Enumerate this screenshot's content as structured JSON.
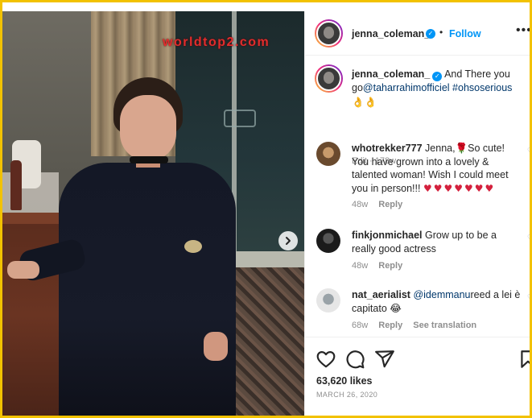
{
  "watermark": "worldtop2.com",
  "header": {
    "username": "jenna_coleman_",
    "separator": "•",
    "follow_label": "Follow",
    "more_label": "•••",
    "verified_mark": "✓"
  },
  "caption": {
    "username": "jenna_coleman_",
    "text": "And There you go",
    "mention": "@taharrahimofficiel",
    "hashtag": "#ohsoserious",
    "emoji": "👌👌",
    "edit_label": "Edit",
    "time": "178w"
  },
  "comments": [
    {
      "username": "whotrekker777",
      "text": "Jenna,🌹So cute! You have grown into a lovely & talented woman! Wish I could meet you in person!!!",
      "hearts": "♥♥♥♥♥♥♥",
      "time": "48w",
      "reply_label": "Reply"
    },
    {
      "username": "finkjonmichael",
      "text": "Grow up to be a really good actress",
      "time": "48w",
      "reply_label": "Reply"
    },
    {
      "username": "nat_aerialist",
      "mention": "@idemmanu",
      "text": "reed a lei è capitato 😂",
      "time": "68w",
      "reply_label": "Reply",
      "translate_label": "See translation"
    }
  ],
  "footer": {
    "likes": "63,620 likes",
    "date": "MARCH 26, 2020"
  },
  "colors": {
    "accent": "#0095f6",
    "border_frame": "#f2c200",
    "watermark": "#e02d2d",
    "heart_red": "#d4213d"
  },
  "icons": [
    "chevron-right-icon",
    "heart-icon",
    "comment-icon",
    "share-icon",
    "bookmark-icon",
    "verified-icon"
  ]
}
